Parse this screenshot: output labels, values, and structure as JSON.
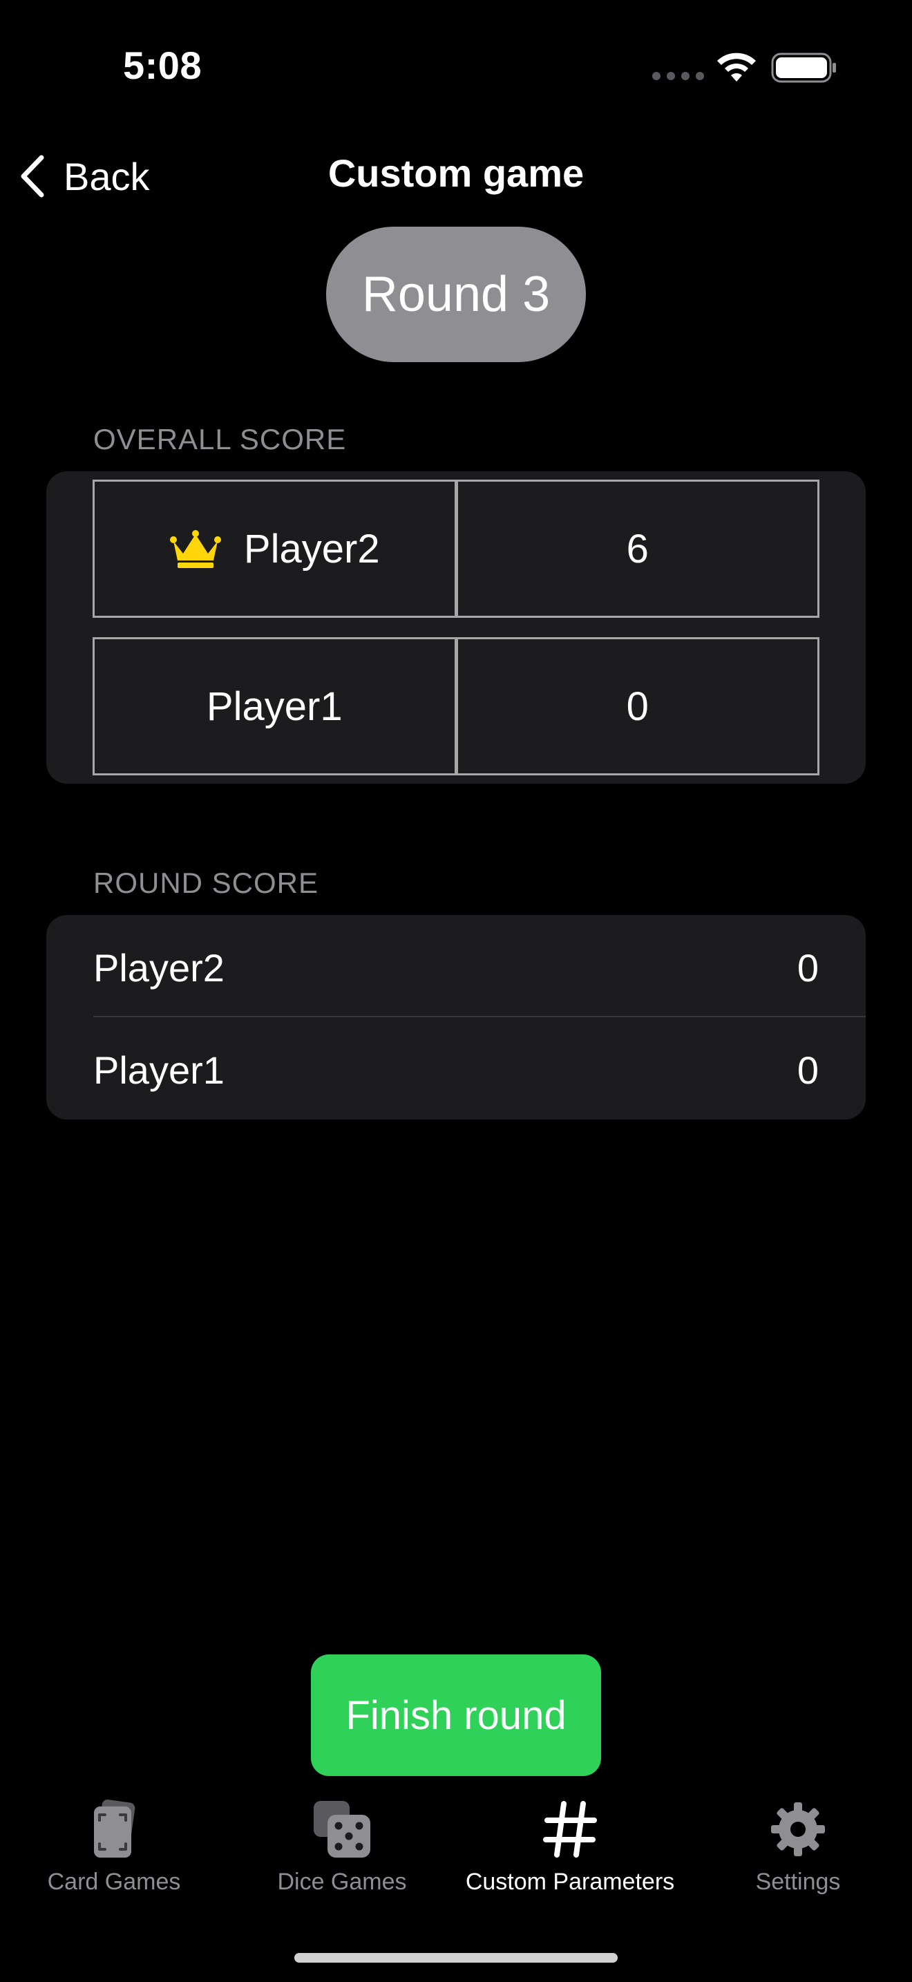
{
  "status_bar": {
    "time": "5:08"
  },
  "nav": {
    "back_label": "Back",
    "title": "Custom game"
  },
  "round_pill": {
    "label": "Round 3"
  },
  "overall_score": {
    "header": "OVERALL SCORE",
    "rows": [
      {
        "player": "Player2",
        "score": "6",
        "leader": true
      },
      {
        "player": "Player1",
        "score": "0",
        "leader": false
      }
    ]
  },
  "round_score": {
    "header": "ROUND SCORE",
    "rows": [
      {
        "player": "Player2",
        "score": "0"
      },
      {
        "player": "Player1",
        "score": "0"
      }
    ]
  },
  "finish_button": {
    "label": "Finish round"
  },
  "tab_bar": {
    "tabs": [
      {
        "label": "Card Games",
        "icon": "cards-icon",
        "active": false
      },
      {
        "label": "Dice Games",
        "icon": "dice-icon",
        "active": false
      },
      {
        "label": "Custom Parameters",
        "icon": "hashtag-icon",
        "active": true
      },
      {
        "label": "Settings",
        "icon": "gear-icon",
        "active": false
      }
    ]
  },
  "colors": {
    "background": "#000000",
    "card": "#1c1c1e",
    "secondary_text": "#8e8e93",
    "pill": "#8e8e93",
    "accent_green": "#30d158",
    "crown": "#ffd60a",
    "grid_border": "#a7a7a7"
  }
}
